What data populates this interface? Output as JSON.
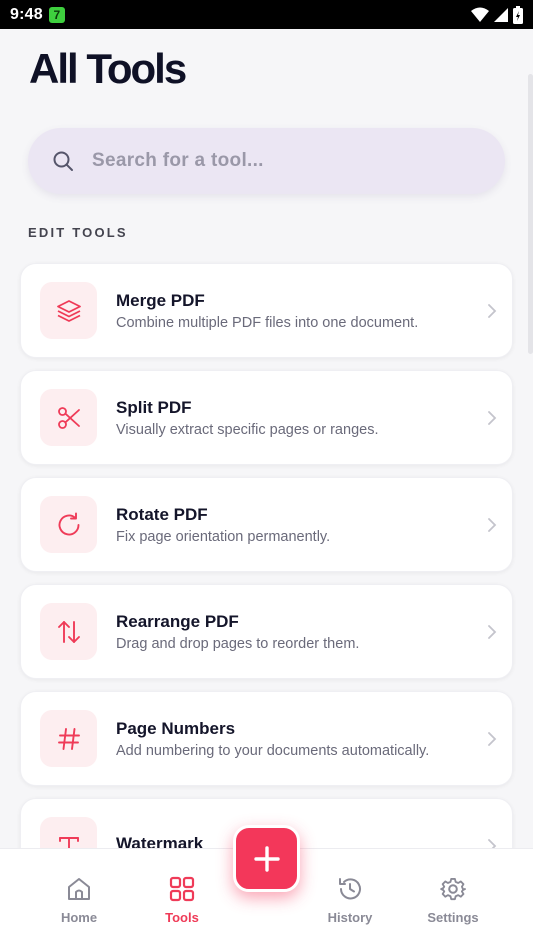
{
  "status_bar": {
    "time": "9:48",
    "badge": "7"
  },
  "page": {
    "title": "All Tools"
  },
  "search": {
    "placeholder": "Search for a tool..."
  },
  "sections": {
    "edit_tools": "EDIT TOOLS"
  },
  "tools": [
    {
      "title": "Merge PDF",
      "description": "Combine multiple PDF files into one document.",
      "icon": "layers-icon"
    },
    {
      "title": "Split PDF",
      "description": "Visually extract specific pages or ranges.",
      "icon": "scissors-icon"
    },
    {
      "title": "Rotate PDF",
      "description": "Fix page orientation permanently.",
      "icon": "rotate-icon"
    },
    {
      "title": "Rearrange PDF",
      "description": "Drag and drop pages to reorder them.",
      "icon": "swap-arrows-icon"
    },
    {
      "title": "Page Numbers",
      "description": "Add numbering to your documents automatically.",
      "icon": "hash-icon"
    },
    {
      "title": "Watermark",
      "description": "",
      "icon": "text-icon"
    }
  ],
  "nav": {
    "home": "Home",
    "tools": "Tools",
    "history": "History",
    "settings": "Settings"
  },
  "colors": {
    "accent": "#ef3b58",
    "icon_bg": "#fdeef0",
    "search_bg": "#ebe6f3"
  }
}
